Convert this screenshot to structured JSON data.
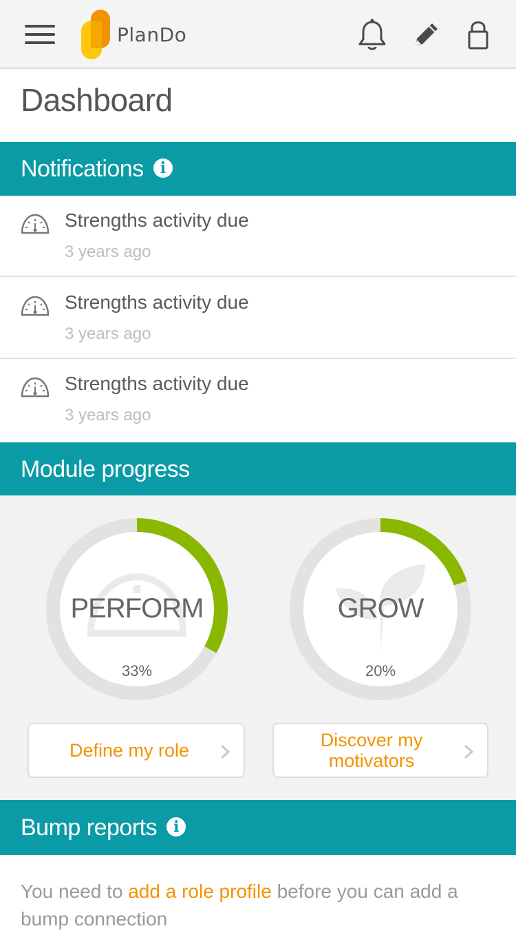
{
  "header": {
    "brand": "PlanDo",
    "icons": [
      "menu-icon",
      "bell-icon",
      "pencil-icon",
      "lock-icon"
    ]
  },
  "page": {
    "title": "Dashboard"
  },
  "notifications": {
    "heading": "Notifications",
    "info_glyph": "i",
    "items": [
      {
        "title": "Strengths activity due",
        "time": "3 years ago",
        "icon": "gauge-icon"
      },
      {
        "title": "Strengths activity due",
        "time": "3 years ago",
        "icon": "gauge-icon"
      },
      {
        "title": "Strengths activity due",
        "time": "3 years ago",
        "icon": "gauge-icon"
      }
    ]
  },
  "module_progress": {
    "heading": "Module progress",
    "modules": [
      {
        "label": "PERFORM",
        "percent_text": "33%",
        "progress": 0.33,
        "button": "Define my role"
      },
      {
        "label": "GROW",
        "percent_text": "20%",
        "progress": 0.2,
        "button": "Discover my motivators"
      }
    ]
  },
  "bump_reports": {
    "heading": "Bump reports",
    "info_glyph": "i",
    "text_before": "You need to ",
    "link": "add a role profile",
    "text_after": " before you can add a bump connection"
  },
  "colors": {
    "teal": "#0a9ba6",
    "orange": "#f39200",
    "progress_green": "#8ab800",
    "ring_track": "#e2e2e0"
  }
}
